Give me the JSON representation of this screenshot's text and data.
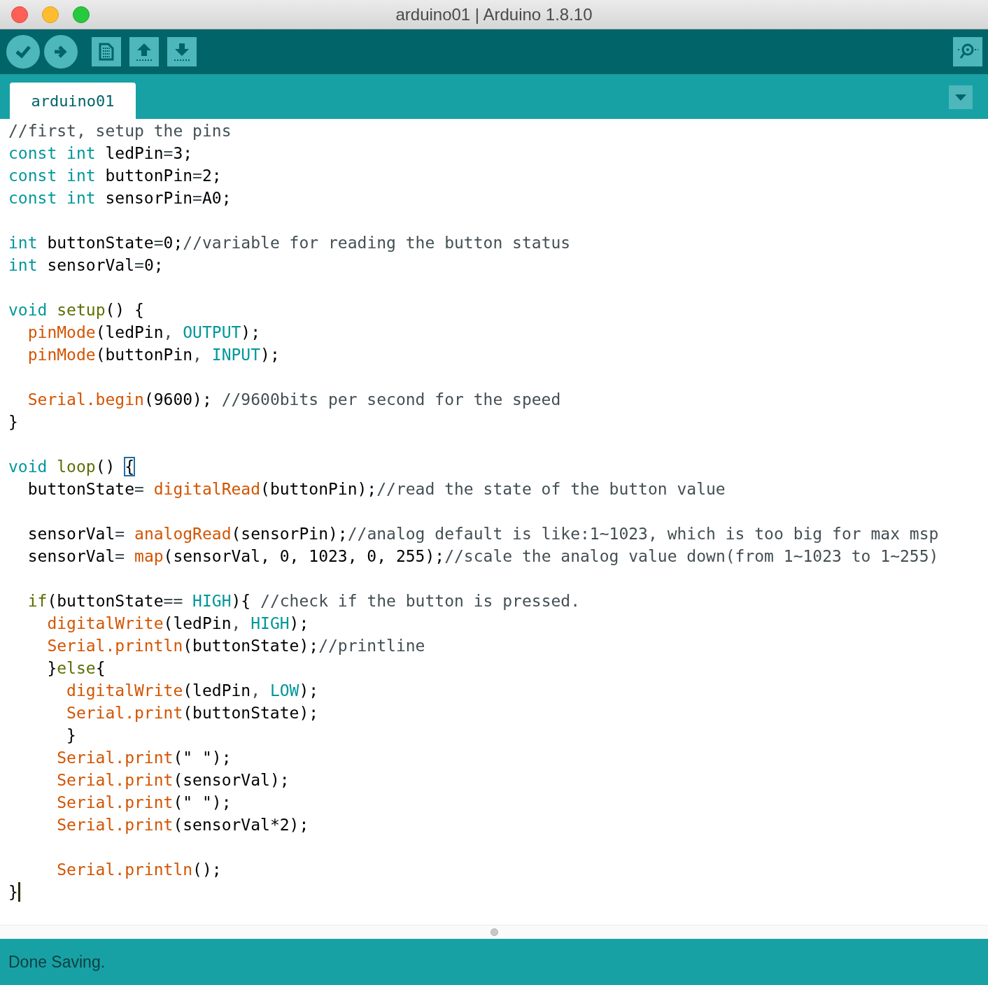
{
  "window": {
    "title": "arduino01 | Arduino 1.8.10"
  },
  "tabs": [
    {
      "label": "arduino01",
      "selected": true
    }
  ],
  "editor": {
    "lines": [
      {
        "kind": "code",
        "tokens": [
          {
            "kind": "comment",
            "text": "//first, setup the pins"
          }
        ]
      },
      {
        "kind": "code",
        "tokens": [
          {
            "kind": "keyword",
            "text": "const int"
          },
          {
            "kind": "plain",
            "text": " ledPin"
          },
          {
            "kind": "operator",
            "text": "="
          },
          {
            "kind": "plain",
            "text": "3;"
          }
        ]
      },
      {
        "kind": "code",
        "tokens": [
          {
            "kind": "keyword",
            "text": "const int"
          },
          {
            "kind": "plain",
            "text": " buttonPin"
          },
          {
            "kind": "operator",
            "text": "="
          },
          {
            "kind": "plain",
            "text": "2;"
          }
        ]
      },
      {
        "kind": "code",
        "tokens": [
          {
            "kind": "keyword",
            "text": "const int"
          },
          {
            "kind": "plain",
            "text": " sensorPin"
          },
          {
            "kind": "operator",
            "text": "="
          },
          {
            "kind": "plain",
            "text": "A0;"
          }
        ]
      },
      {
        "kind": "blank"
      },
      {
        "kind": "code",
        "tokens": [
          {
            "kind": "keyword",
            "text": "int"
          },
          {
            "kind": "plain",
            "text": " buttonState"
          },
          {
            "kind": "operator",
            "text": "="
          },
          {
            "kind": "plain",
            "text": "0;"
          },
          {
            "kind": "comment",
            "text": "//variable for reading the button status"
          }
        ]
      },
      {
        "kind": "code",
        "tokens": [
          {
            "kind": "keyword",
            "text": "int"
          },
          {
            "kind": "plain",
            "text": " sensorVal"
          },
          {
            "kind": "operator",
            "text": "="
          },
          {
            "kind": "plain",
            "text": "0;"
          }
        ]
      },
      {
        "kind": "blank"
      },
      {
        "kind": "code",
        "tokens": [
          {
            "kind": "keyword",
            "text": "void"
          },
          {
            "kind": "structure",
            "text": " setup"
          },
          {
            "kind": "plain",
            "text": "() {"
          }
        ]
      },
      {
        "kind": "code",
        "tokens": [
          {
            "kind": "function",
            "text": "  pinMode"
          },
          {
            "kind": "plain",
            "text": "(ledPin"
          },
          {
            "kind": "operator",
            "text": ","
          },
          {
            "kind": "constant",
            "text": " OUTPUT"
          },
          {
            "kind": "plain",
            "text": ");"
          }
        ]
      },
      {
        "kind": "code",
        "tokens": [
          {
            "kind": "function",
            "text": "  pinMode"
          },
          {
            "kind": "plain",
            "text": "(buttonPin"
          },
          {
            "kind": "operator",
            "text": ","
          },
          {
            "kind": "constant",
            "text": " INPUT"
          },
          {
            "kind": "plain",
            "text": ");"
          }
        ]
      },
      {
        "kind": "blank"
      },
      {
        "kind": "code",
        "tokens": [
          {
            "kind": "function",
            "text": "  Serial.begin"
          },
          {
            "kind": "plain",
            "text": "(9600); "
          },
          {
            "kind": "comment",
            "text": "//9600bits per second for the speed"
          }
        ]
      },
      {
        "kind": "code",
        "tokens": [
          {
            "kind": "plain",
            "text": "}"
          }
        ]
      },
      {
        "kind": "blank"
      },
      {
        "kind": "code",
        "tokens": [
          {
            "kind": "keyword",
            "text": "void"
          },
          {
            "kind": "structure",
            "text": " loop"
          },
          {
            "kind": "plain",
            "text": "() "
          },
          {
            "kind": "matched_bracket",
            "text": "{"
          }
        ]
      },
      {
        "kind": "code",
        "tokens": [
          {
            "kind": "plain",
            "text": "  buttonState"
          },
          {
            "kind": "operator",
            "text": "="
          },
          {
            "kind": "function",
            "text": " digitalRead"
          },
          {
            "kind": "plain",
            "text": "(buttonPin);"
          },
          {
            "kind": "comment",
            "text": "//read the state of the button value"
          }
        ]
      },
      {
        "kind": "blank"
      },
      {
        "kind": "code",
        "tokens": [
          {
            "kind": "plain",
            "text": "  sensorVal"
          },
          {
            "kind": "operator",
            "text": "="
          },
          {
            "kind": "function",
            "text": " analogRead"
          },
          {
            "kind": "plain",
            "text": "(sensorPin);"
          },
          {
            "kind": "comment",
            "text": "//analog default is like:1~1023, which is too big for max msp"
          }
        ]
      },
      {
        "kind": "code",
        "tokens": [
          {
            "kind": "plain",
            "text": "  sensorVal"
          },
          {
            "kind": "operator",
            "text": "="
          },
          {
            "kind": "function",
            "text": " map"
          },
          {
            "kind": "plain",
            "text": "(sensorVal, 0, 1023, 0, 255);"
          },
          {
            "kind": "comment",
            "text": "//scale the analog value down(from 1~1023 to 1~255)"
          }
        ]
      },
      {
        "kind": "blank"
      },
      {
        "kind": "code",
        "tokens": [
          {
            "kind": "structure",
            "text": "  if"
          },
          {
            "kind": "plain",
            "text": "(buttonState"
          },
          {
            "kind": "operator",
            "text": "=="
          },
          {
            "kind": "constant",
            "text": " HIGH"
          },
          {
            "kind": "plain",
            "text": "){ "
          },
          {
            "kind": "comment",
            "text": "//check if the button is pressed."
          }
        ]
      },
      {
        "kind": "code",
        "tokens": [
          {
            "kind": "function",
            "text": "    digitalWrite"
          },
          {
            "kind": "plain",
            "text": "(ledPin"
          },
          {
            "kind": "operator",
            "text": ","
          },
          {
            "kind": "constant",
            "text": " HIGH"
          },
          {
            "kind": "plain",
            "text": ");"
          }
        ]
      },
      {
        "kind": "code",
        "tokens": [
          {
            "kind": "function",
            "text": "    Serial.println"
          },
          {
            "kind": "plain",
            "text": "(buttonState);"
          },
          {
            "kind": "comment",
            "text": "//printline"
          }
        ]
      },
      {
        "kind": "code",
        "tokens": [
          {
            "kind": "plain",
            "text": "    }"
          },
          {
            "kind": "structure",
            "text": "else"
          },
          {
            "kind": "plain",
            "text": "{"
          }
        ]
      },
      {
        "kind": "code",
        "tokens": [
          {
            "kind": "function",
            "text": "      digitalWrite"
          },
          {
            "kind": "plain",
            "text": "(ledPin"
          },
          {
            "kind": "operator",
            "text": ","
          },
          {
            "kind": "constant",
            "text": " LOW"
          },
          {
            "kind": "plain",
            "text": ");"
          }
        ]
      },
      {
        "kind": "code",
        "tokens": [
          {
            "kind": "function",
            "text": "      Serial.print"
          },
          {
            "kind": "plain",
            "text": "(buttonState);"
          }
        ]
      },
      {
        "kind": "code",
        "tokens": [
          {
            "kind": "plain",
            "text": "      }"
          }
        ]
      },
      {
        "kind": "code",
        "tokens": [
          {
            "kind": "function",
            "text": "     Serial.print"
          },
          {
            "kind": "plain",
            "text": "(\" \");"
          }
        ]
      },
      {
        "kind": "code",
        "tokens": [
          {
            "kind": "function",
            "text": "     Serial.print"
          },
          {
            "kind": "plain",
            "text": "(sensorVal);"
          }
        ]
      },
      {
        "kind": "code",
        "tokens": [
          {
            "kind": "function",
            "text": "     Serial.print"
          },
          {
            "kind": "plain",
            "text": "(\" \");"
          }
        ]
      },
      {
        "kind": "code",
        "tokens": [
          {
            "kind": "function",
            "text": "     Serial.print"
          },
          {
            "kind": "plain",
            "text": "(sensorVal*2);"
          }
        ]
      },
      {
        "kind": "blank"
      },
      {
        "kind": "code",
        "tokens": [
          {
            "kind": "function",
            "text": "     Serial.println"
          },
          {
            "kind": "plain",
            "text": "();"
          }
        ]
      },
      {
        "kind": "code",
        "tokens": [
          {
            "kind": "plain",
            "text": "}"
          },
          {
            "kind": "caret"
          }
        ]
      }
    ]
  },
  "status_bar": {
    "message": "Done Saving."
  }
}
